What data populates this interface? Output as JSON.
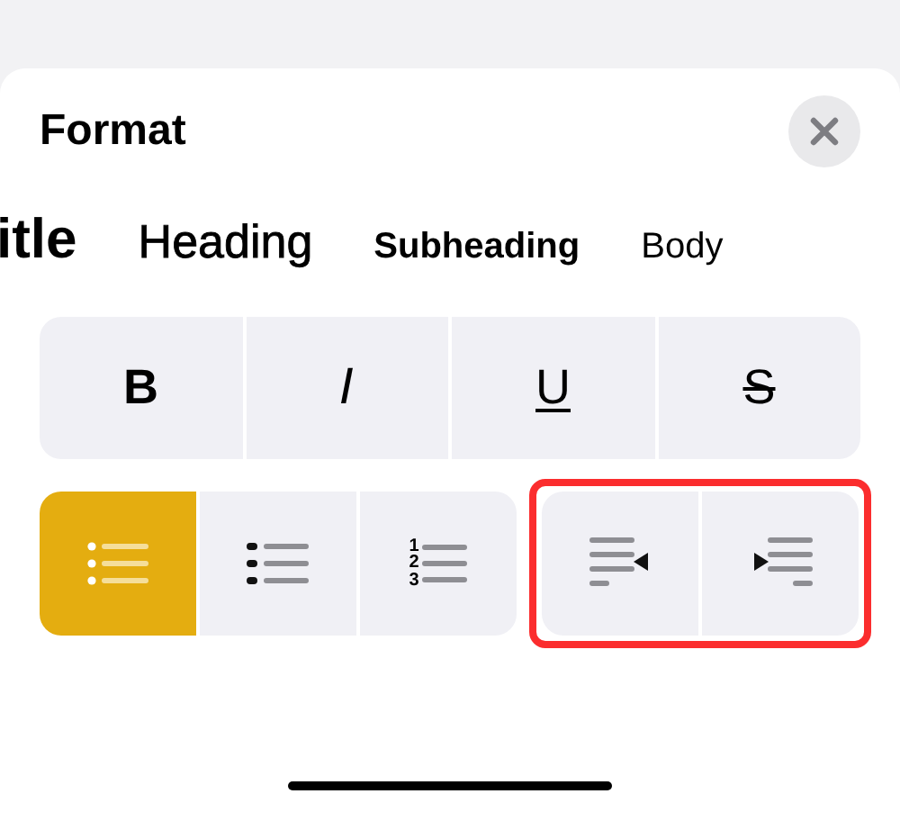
{
  "sheet": {
    "title": "Format"
  },
  "text_styles": [
    {
      "label": "itle",
      "kind": "title"
    },
    {
      "label": "Heading",
      "kind": "heading"
    },
    {
      "label": "Subheading",
      "kind": "subheading"
    },
    {
      "label": "Body",
      "kind": "body"
    }
  ],
  "font_buttons": [
    {
      "label": "B",
      "kind": "bold"
    },
    {
      "label": "I",
      "kind": "italic"
    },
    {
      "label": "U",
      "kind": "underline"
    },
    {
      "label": "S",
      "kind": "strikethrough"
    }
  ],
  "list_buttons": [
    {
      "kind": "bullet",
      "selected": true
    },
    {
      "kind": "dashed",
      "selected": false
    },
    {
      "kind": "numbered",
      "selected": false,
      "numbers": [
        "1",
        "2",
        "3"
      ]
    }
  ],
  "indent": {
    "highlighted": true,
    "buttons": [
      {
        "kind": "outdent"
      },
      {
        "kind": "indent"
      }
    ]
  }
}
